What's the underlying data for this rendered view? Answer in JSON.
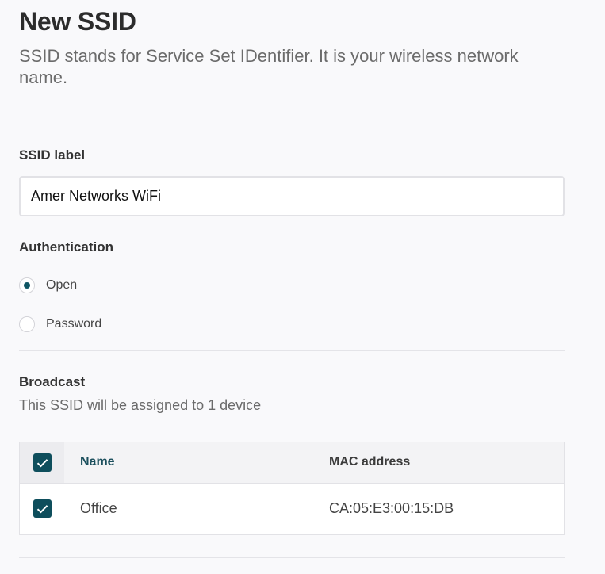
{
  "header": {
    "title": "New SSID",
    "subtitle": "SSID stands for Service Set IDentifier. It is your wireless network name."
  },
  "ssid": {
    "label": "SSID label",
    "value": "Amer Networks WiFi"
  },
  "authentication": {
    "label": "Authentication",
    "options": [
      {
        "label": "Open",
        "selected": true
      },
      {
        "label": "Password",
        "selected": false
      }
    ]
  },
  "broadcast": {
    "label": "Broadcast",
    "helper": "This SSID will be assigned to 1 device"
  },
  "table": {
    "all_selected": true,
    "columns": [
      "Name",
      "MAC address"
    ],
    "rows": [
      {
        "selected": true,
        "name": "Office",
        "mac": "CA:05:E3:00:15:DB"
      }
    ]
  },
  "colors": {
    "accent": "#0e5563",
    "checkbox": "#0e4e5c",
    "column_accent": "#1a4e5c"
  },
  "icons": {
    "checkbox_mark": "check-icon",
    "radio_selected": "radio-dot"
  }
}
